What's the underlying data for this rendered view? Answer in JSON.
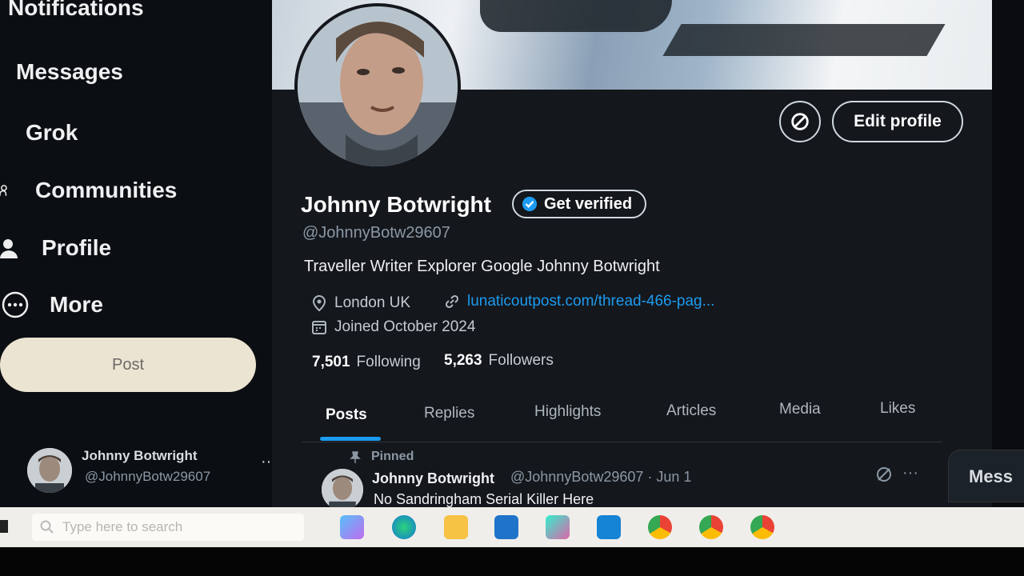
{
  "nav": {
    "items": [
      {
        "label": "Notifications"
      },
      {
        "label": "Messages"
      },
      {
        "label": "Grok"
      },
      {
        "label": "Communities"
      },
      {
        "label": "Profile"
      },
      {
        "label": "More"
      }
    ],
    "post_label": "Post",
    "account": {
      "name": "Johnny Botwright",
      "handle": "@JohnnyBotw29607",
      "more": "···"
    }
  },
  "profile": {
    "name": "Johnny Botwright",
    "handle": "@JohnnyBotw29607",
    "get_verified": "Get verified",
    "edit_profile": "Edit profile",
    "bio": "Traveller  Writer Explorer Google Johnny Botwright",
    "location": "London  UK",
    "link": "lunaticoutpost.com/thread-466-pag...",
    "joined": "Joined October 2024",
    "following_count": "7,501",
    "following_label": "Following",
    "followers_count": "5,263",
    "followers_label": "Followers"
  },
  "tabs": [
    {
      "label": "Posts",
      "active": true
    },
    {
      "label": "Replies"
    },
    {
      "label": "Highlights"
    },
    {
      "label": "Articles"
    },
    {
      "label": "Media"
    },
    {
      "label": "Likes"
    }
  ],
  "pinned_post": {
    "pinned_label": "Pinned",
    "author": "Johnny Botwright",
    "handle_date": "@JohnnyBotw29607 · Jun 1",
    "text": "No Sandringham Serial Killer Here",
    "more": "···"
  },
  "right": {
    "messages_label": "Mess"
  },
  "taskbar": {
    "search_placeholder": "Type here to search"
  },
  "colors": {
    "accent": "#1d9bf0",
    "background": "#14171c",
    "post_button": "#ece4d2"
  }
}
